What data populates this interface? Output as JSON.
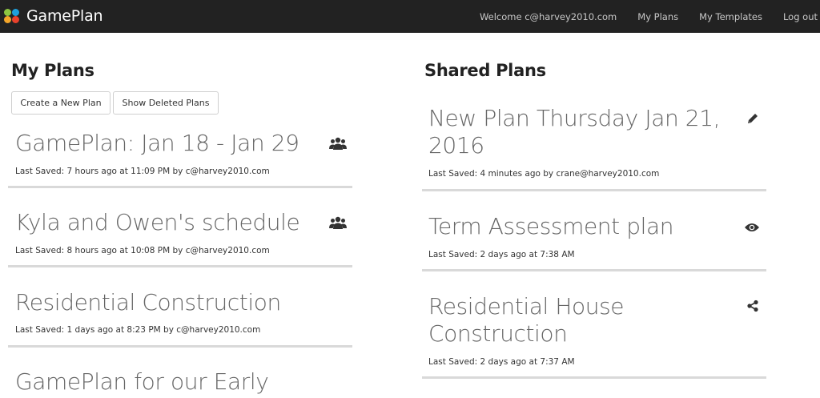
{
  "app": {
    "brand": "GamePlan",
    "colors": {
      "topbar": "#222222",
      "logo_green": "#8ec641",
      "logo_blue": "#1ea0dc",
      "logo_orange": "#f4a62a",
      "logo_red": "#e8412c"
    }
  },
  "nav": {
    "welcome": "Welcome c@harvey2010.com",
    "my_plans": "My Plans",
    "my_templates": "My Templates",
    "logout": "Log out"
  },
  "my_plans": {
    "heading": "My Plans",
    "create_button": "Create a New Plan",
    "deleted_button": "Show Deleted Plans",
    "plans": [
      {
        "title": "GamePlan: Jan 18 - Jan 29",
        "meta": "Last Saved: 7 hours ago at 11:09 PM by c@harvey2010.com",
        "icon": "users-icon"
      },
      {
        "title": "Kyla and Owen's schedule",
        "meta": "Last Saved: 8 hours ago at 10:08 PM by c@harvey2010.com",
        "icon": "users-icon"
      },
      {
        "title": "Residential Construction",
        "meta": "Last Saved: 1 days ago at 8:23 PM by c@harvey2010.com",
        "icon": ""
      },
      {
        "title": "GamePlan for our Early",
        "meta": "",
        "icon": ""
      }
    ]
  },
  "shared_plans": {
    "heading": "Shared Plans",
    "plans": [
      {
        "title_line1": "New Plan Thursday Jan 21,",
        "title_line2": "2016",
        "meta": "Last Saved: 4 minutes ago by crane@harvey2010.com",
        "icon": "pencil-icon"
      },
      {
        "title_line1": "Term Assessment plan",
        "title_line2": "",
        "meta": "Last Saved: 2 days ago at 7:38 AM",
        "icon": "eye-icon"
      },
      {
        "title_line1": "Residential House",
        "title_line2": "Construction",
        "meta": "Last Saved: 2 days ago at 7:37 AM",
        "icon": "share-icon"
      }
    ]
  }
}
